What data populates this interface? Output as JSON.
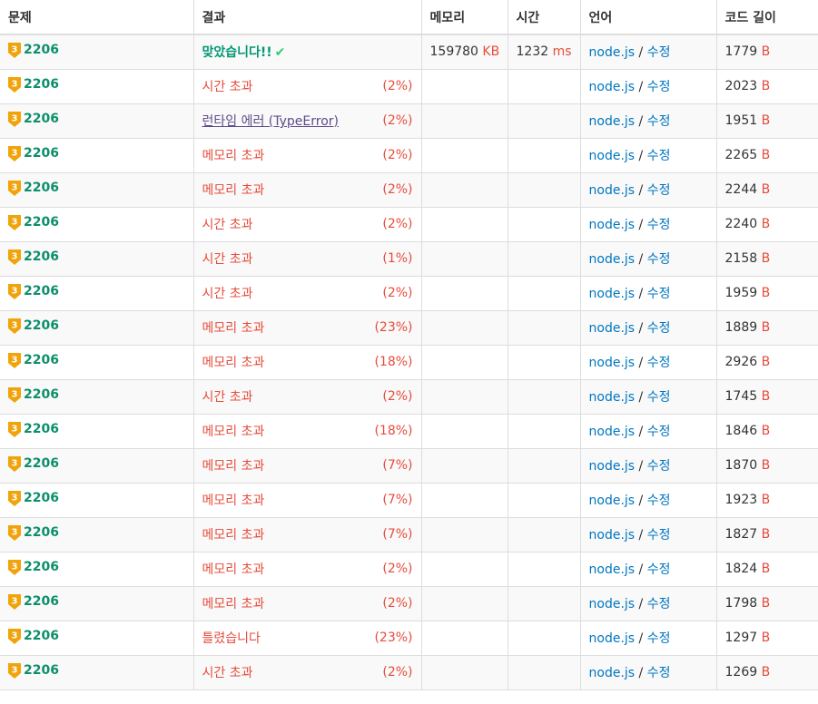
{
  "headers": [
    "문제",
    "결과",
    "메모리",
    "시간",
    "언어",
    "코드 길이"
  ],
  "colors": {
    "accepted": "#009874",
    "error": "#e74c3c",
    "runtime": "#5f4b8b",
    "problem": "#0c8f6b",
    "tier": "#f0a30a",
    "link": "#0076c0"
  },
  "rows": [
    {
      "problem": "2206",
      "result": "맞았습니다!!",
      "type": "ac",
      "pct": "",
      "memory": "159780",
      "memory_unit": "KB",
      "time": "1232",
      "time_unit": "ms",
      "lang": "node.js",
      "edit": "수정",
      "length": "1779",
      "length_unit": "B"
    },
    {
      "problem": "2206",
      "result": "시간 초과",
      "type": "err",
      "pct": "(2%)",
      "memory": "",
      "memory_unit": "",
      "time": "",
      "time_unit": "",
      "lang": "node.js",
      "edit": "수정",
      "length": "2023",
      "length_unit": "B"
    },
    {
      "problem": "2206",
      "result": "런타임 에러 (TypeError)",
      "type": "rte",
      "pct": "(2%)",
      "memory": "",
      "memory_unit": "",
      "time": "",
      "time_unit": "",
      "lang": "node.js",
      "edit": "수정",
      "length": "1951",
      "length_unit": "B"
    },
    {
      "problem": "2206",
      "result": "메모리 초과",
      "type": "err",
      "pct": "(2%)",
      "memory": "",
      "memory_unit": "",
      "time": "",
      "time_unit": "",
      "lang": "node.js",
      "edit": "수정",
      "length": "2265",
      "length_unit": "B"
    },
    {
      "problem": "2206",
      "result": "메모리 초과",
      "type": "err",
      "pct": "(2%)",
      "memory": "",
      "memory_unit": "",
      "time": "",
      "time_unit": "",
      "lang": "node.js",
      "edit": "수정",
      "length": "2244",
      "length_unit": "B"
    },
    {
      "problem": "2206",
      "result": "시간 초과",
      "type": "err",
      "pct": "(2%)",
      "memory": "",
      "memory_unit": "",
      "time": "",
      "time_unit": "",
      "lang": "node.js",
      "edit": "수정",
      "length": "2240",
      "length_unit": "B"
    },
    {
      "problem": "2206",
      "result": "시간 초과",
      "type": "err",
      "pct": "(1%)",
      "memory": "",
      "memory_unit": "",
      "time": "",
      "time_unit": "",
      "lang": "node.js",
      "edit": "수정",
      "length": "2158",
      "length_unit": "B"
    },
    {
      "problem": "2206",
      "result": "시간 초과",
      "type": "err",
      "pct": "(2%)",
      "memory": "",
      "memory_unit": "",
      "time": "",
      "time_unit": "",
      "lang": "node.js",
      "edit": "수정",
      "length": "1959",
      "length_unit": "B"
    },
    {
      "problem": "2206",
      "result": "메모리 초과",
      "type": "err",
      "pct": "(23%)",
      "memory": "",
      "memory_unit": "",
      "time": "",
      "time_unit": "",
      "lang": "node.js",
      "edit": "수정",
      "length": "1889",
      "length_unit": "B"
    },
    {
      "problem": "2206",
      "result": "메모리 초과",
      "type": "err",
      "pct": "(18%)",
      "memory": "",
      "memory_unit": "",
      "time": "",
      "time_unit": "",
      "lang": "node.js",
      "edit": "수정",
      "length": "2926",
      "length_unit": "B"
    },
    {
      "problem": "2206",
      "result": "시간 초과",
      "type": "err",
      "pct": "(2%)",
      "memory": "",
      "memory_unit": "",
      "time": "",
      "time_unit": "",
      "lang": "node.js",
      "edit": "수정",
      "length": "1745",
      "length_unit": "B"
    },
    {
      "problem": "2206",
      "result": "메모리 초과",
      "type": "err",
      "pct": "(18%)",
      "memory": "",
      "memory_unit": "",
      "time": "",
      "time_unit": "",
      "lang": "node.js",
      "edit": "수정",
      "length": "1846",
      "length_unit": "B"
    },
    {
      "problem": "2206",
      "result": "메모리 초과",
      "type": "err",
      "pct": "(7%)",
      "memory": "",
      "memory_unit": "",
      "time": "",
      "time_unit": "",
      "lang": "node.js",
      "edit": "수정",
      "length": "1870",
      "length_unit": "B"
    },
    {
      "problem": "2206",
      "result": "메모리 초과",
      "type": "err",
      "pct": "(7%)",
      "memory": "",
      "memory_unit": "",
      "time": "",
      "time_unit": "",
      "lang": "node.js",
      "edit": "수정",
      "length": "1923",
      "length_unit": "B"
    },
    {
      "problem": "2206",
      "result": "메모리 초과",
      "type": "err",
      "pct": "(7%)",
      "memory": "",
      "memory_unit": "",
      "time": "",
      "time_unit": "",
      "lang": "node.js",
      "edit": "수정",
      "length": "1827",
      "length_unit": "B"
    },
    {
      "problem": "2206",
      "result": "메모리 초과",
      "type": "err",
      "pct": "(2%)",
      "memory": "",
      "memory_unit": "",
      "time": "",
      "time_unit": "",
      "lang": "node.js",
      "edit": "수정",
      "length": "1824",
      "length_unit": "B"
    },
    {
      "problem": "2206",
      "result": "메모리 초과",
      "type": "err",
      "pct": "(2%)",
      "memory": "",
      "memory_unit": "",
      "time": "",
      "time_unit": "",
      "lang": "node.js",
      "edit": "수정",
      "length": "1798",
      "length_unit": "B"
    },
    {
      "problem": "2206",
      "result": "틀렸습니다",
      "type": "wa",
      "pct": "(23%)",
      "memory": "",
      "memory_unit": "",
      "time": "",
      "time_unit": "",
      "lang": "node.js",
      "edit": "수정",
      "length": "1297",
      "length_unit": "B"
    },
    {
      "problem": "2206",
      "result": "시간 초과",
      "type": "err",
      "pct": "(2%)",
      "memory": "",
      "memory_unit": "",
      "time": "",
      "time_unit": "",
      "lang": "node.js",
      "edit": "수정",
      "length": "1269",
      "length_unit": "B"
    }
  ],
  "tier_icon": "gold-tier-3-icon",
  "tier_label": "3",
  "check_icon": "✔"
}
